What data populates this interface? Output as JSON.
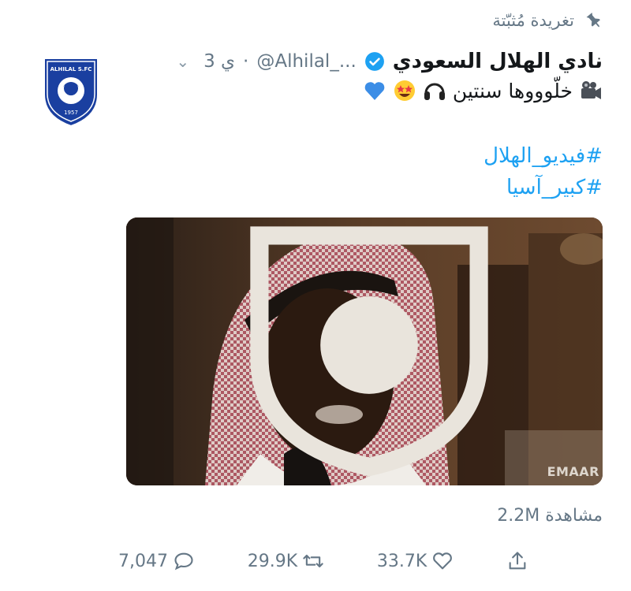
{
  "pinned": {
    "label": "تغريدة مُثبّتة",
    "icon": "pin-icon"
  },
  "author": {
    "name": "نادي الهلال السعودي",
    "handle": "@Alhilal_...",
    "time": "3 ي",
    "separator": "·",
    "verified": true,
    "avatar_text": "ALHILAL S.FC",
    "avatar_year": "1957"
  },
  "tweet": {
    "text": "خلّوووها سنتين",
    "emojis": [
      "movie-camera-icon",
      "headphones-icon",
      "star-struck-icon",
      "blue-heart-icon"
    ]
  },
  "hashtags": [
    "#فيديو_الهلال",
    "#كبير_آسيا"
  ],
  "media": {
    "watermark": "EMAAR"
  },
  "views": {
    "count": "2.2M",
    "label": "مشاهدة"
  },
  "actions": {
    "replies": "7,047",
    "retweets": "29.9K",
    "likes": "33.7K"
  },
  "colors": {
    "accent": "#1da1f2",
    "muted": "#657786",
    "club_blue": "#1a3fa0"
  }
}
